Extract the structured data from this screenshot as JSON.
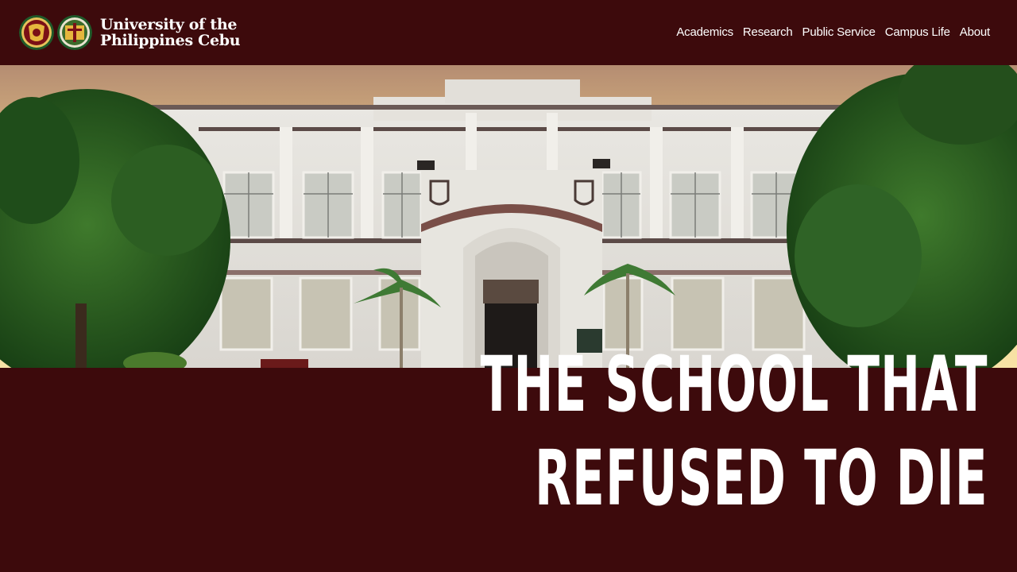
{
  "brand": {
    "line1": "University of the",
    "line2": "Philippines Cebu",
    "logos": [
      "up-seal-icon",
      "up-cebu-seal-icon"
    ]
  },
  "nav": {
    "items": [
      {
        "label": "Academics"
      },
      {
        "label": "Research"
      },
      {
        "label": "Public Service"
      },
      {
        "label": "Campus Life"
      },
      {
        "label": "About"
      }
    ]
  },
  "hero": {
    "headline_line1": "The School That",
    "headline_line2": "Refused to Die"
  },
  "colors": {
    "maroon": "#3d0a0c",
    "text": "#ffffff"
  }
}
